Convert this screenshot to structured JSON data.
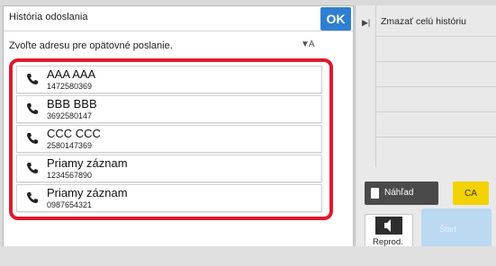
{
  "dialog": {
    "title": "História odoslania",
    "ok_label": "OK",
    "instruction": "Zvoľte adresu pre opätovné poslanie.",
    "sort_icon": "sort-az-icon",
    "entries": [
      {
        "name": "AAA AAA",
        "number": "1472580369",
        "icon": "phone-icon"
      },
      {
        "name": "BBB BBB",
        "number": "3692580147",
        "icon": "phone-icon"
      },
      {
        "name": "CCC CCC",
        "number": "2580147369",
        "icon": "phone-icon"
      },
      {
        "name": "Priamy záznam",
        "number": "1234567890",
        "icon": "phone-icon"
      },
      {
        "name": "Priamy záznam",
        "number": "0987654321",
        "icon": "phone-icon"
      }
    ]
  },
  "side_panel": {
    "menu_items": [
      "Zmazať celú históriu"
    ],
    "preview_label": "Náhľad",
    "ca_label": "CA",
    "reprod_label": "Reprod.",
    "start_label": "Štart"
  },
  "colors": {
    "ok_button": "#2f7fd0",
    "highlight_frame": "#e0192f",
    "ca_button": "#f2d200",
    "start_button": "#bcd9f2"
  }
}
